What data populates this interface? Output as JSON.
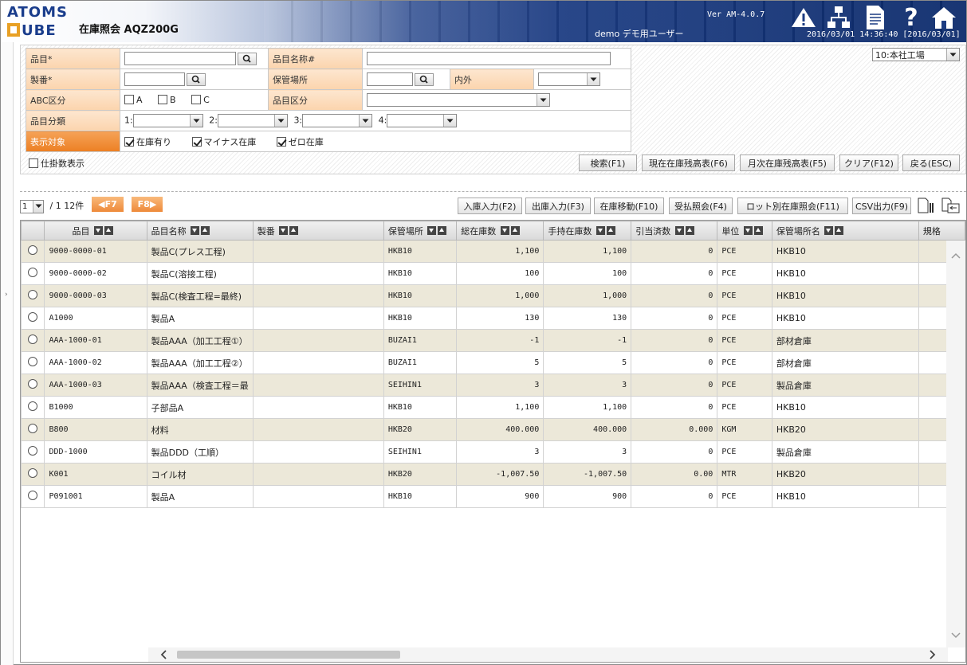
{
  "header": {
    "logo_line1": "ATOMS",
    "logo_line2": "UBE",
    "title": "在庫照会 AQZ200G",
    "version": "Ver AM-4.0.7",
    "user": "demo デモ用ユーザー",
    "datetime": "2016/03/01 14:36:40 [2016/03/01]",
    "icons": [
      "warning-icon",
      "sitemap-icon",
      "document-icon",
      "help-icon",
      "home-icon"
    ]
  },
  "plant_select": "10:本社工場",
  "search": {
    "item_label": "品目*",
    "item_name_label": "品目名称#",
    "seiban_label": "製番*",
    "location_label": "保管場所",
    "inout_label": "内外",
    "abc_label": "ABC区分",
    "abc_options": [
      "A",
      "B",
      "C"
    ],
    "item_class_label": "品目区分",
    "item_category_label": "品目分類",
    "category_prefixes": [
      "1:",
      "2:",
      "3:",
      "4:"
    ],
    "display_label": "表示対象",
    "display_options": [
      "在庫有り",
      "マイナス在庫",
      "ゼロ在庫"
    ],
    "show_shikake": "仕掛数表示"
  },
  "buttons": {
    "search": "検索(F1)",
    "current_stock": "現在在庫残高表(F6)",
    "monthly_stock": "月次在庫残高表(F5)",
    "clear": "クリア(F12)",
    "back": "戻る(ESC)"
  },
  "pager": {
    "page": "1",
    "total": "/ 1 12件",
    "prev": "◀F7",
    "next": "F8▶"
  },
  "toolbar": {
    "receipt": "入庫入力(F2)",
    "issue": "出庫入力(F3)",
    "move": "在庫移動(F10)",
    "payment": "受払照会(F4)",
    "lot": "ロット別在庫照会(F11)",
    "csv": "CSV出力(F9)"
  },
  "columns": [
    "品目",
    "品目名称",
    "製番",
    "保管場所",
    "総在庫数",
    "手持在庫数",
    "引当済数",
    "単位",
    "保管場所名",
    "規格"
  ],
  "rows": [
    [
      "9000-0000-01",
      "製品C(プレス工程)",
      "",
      "HKB10",
      "1,100",
      "1,100",
      "0",
      "PCE",
      "HKB10"
    ],
    [
      "9000-0000-02",
      "製品C(溶接工程)",
      "",
      "HKB10",
      "100",
      "100",
      "0",
      "PCE",
      "HKB10"
    ],
    [
      "9000-0000-03",
      "製品C(検査工程=最終)",
      "",
      "HKB10",
      "1,000",
      "1,000",
      "0",
      "PCE",
      "HKB10"
    ],
    [
      "A1000",
      "製品A",
      "",
      "HKB10",
      "130",
      "130",
      "0",
      "PCE",
      "HKB10"
    ],
    [
      "AAA-1000-01",
      "製品AAA（加工工程①）",
      "",
      "BUZAI1",
      "-1",
      "-1",
      "0",
      "PCE",
      "部材倉庫"
    ],
    [
      "AAA-1000-02",
      "製品AAA（加工工程②）",
      "",
      "BUZAI1",
      "5",
      "5",
      "0",
      "PCE",
      "部材倉庫"
    ],
    [
      "AAA-1000-03",
      "製品AAA（検査工程＝最",
      "",
      "SEIHIN1",
      "3",
      "3",
      "0",
      "PCE",
      "製品倉庫"
    ],
    [
      "B1000",
      "子部品A",
      "",
      "HKB10",
      "1,100",
      "1,100",
      "0",
      "PCE",
      "HKB10"
    ],
    [
      "B800",
      "材料",
      "",
      "HKB20",
      "400.000",
      "400.000",
      "0.000",
      "KGM",
      "HKB20"
    ],
    [
      "DDD-1000",
      "製品DDD（工順）",
      "",
      "SEIHIN1",
      "3",
      "3",
      "0",
      "PCE",
      "製品倉庫"
    ],
    [
      "K001",
      "コイル材",
      "",
      "HKB20",
      "-1,007.50",
      "-1,007.50",
      "0.00",
      "MTR",
      "HKB20"
    ],
    [
      "P091001",
      "製品A",
      "",
      "HKB10",
      "900",
      "900",
      "0",
      "PCE",
      "HKB10"
    ]
  ]
}
